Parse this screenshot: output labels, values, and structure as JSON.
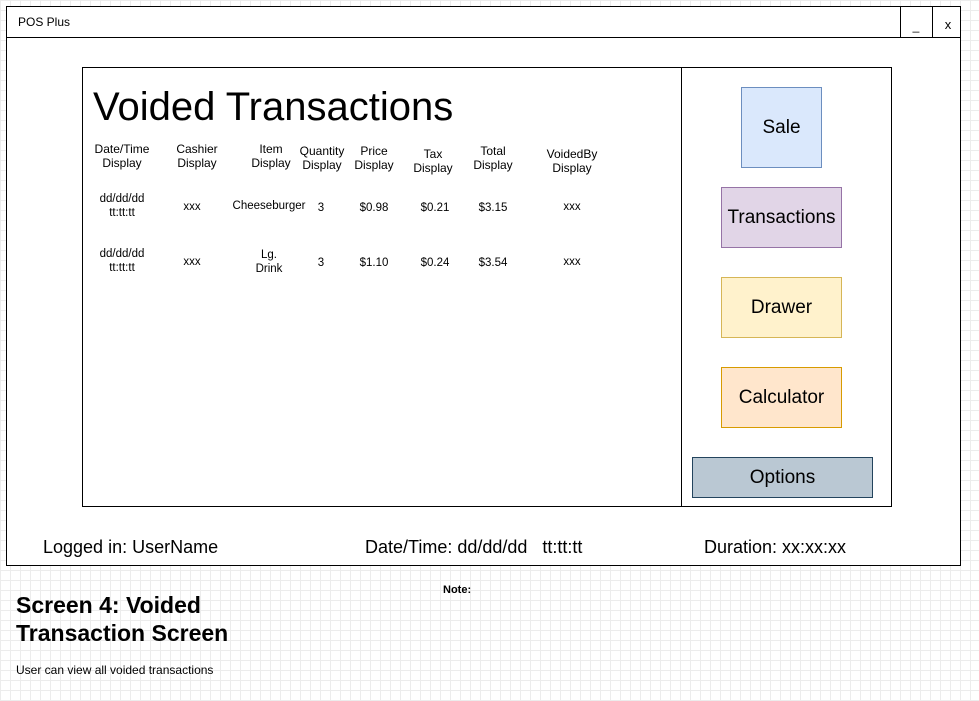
{
  "window": {
    "title": "POS Plus",
    "minimize_label": "_",
    "close_label": "x"
  },
  "main": {
    "title": "Voided Transactions",
    "columns": [
      [
        "Date/Time",
        "Display"
      ],
      [
        "Cashier",
        "Display"
      ],
      [
        "Item",
        "Display"
      ],
      [
        "Quantity",
        "Display"
      ],
      [
        "Price",
        "Display"
      ],
      [
        "Tax",
        "Display"
      ],
      [
        "Total",
        "Display"
      ],
      [
        "VoidedBy",
        "Display"
      ]
    ],
    "rows": [
      [
        [
          "dd/dd/dd",
          "tt:tt:tt"
        ],
        [
          "xxx"
        ],
        [
          "Cheeseburger"
        ],
        [
          "3"
        ],
        [
          "$0.98"
        ],
        [
          "$0.21"
        ],
        [
          "$3.15"
        ],
        [
          "xxx"
        ]
      ],
      [
        [
          "dd/dd/dd",
          "tt:tt:tt"
        ],
        [
          "xxx"
        ],
        [
          "Lg.",
          "Drink"
        ],
        [
          "3"
        ],
        [
          "$1.10"
        ],
        [
          "$0.24"
        ],
        [
          "$3.54"
        ],
        [
          "xxx"
        ]
      ]
    ]
  },
  "sidebar": {
    "sale": "Sale",
    "transactions": "Transactions",
    "drawer": "Drawer",
    "calculator": "Calculator",
    "options": "Options",
    "colors": {
      "sale": "#dae8fc",
      "transactions": "#e1d5e7",
      "drawer": "#fff2cc",
      "calculator": "#ffe6cc",
      "options": "#bac8d3"
    }
  },
  "status": {
    "logged_in": "Logged in: UserName",
    "datetime": "Date/Time: dd/dd/dd   tt:tt:tt",
    "duration": "Duration: xx:xx:xx"
  },
  "annotation": {
    "title_line1": "Screen 4: Voided",
    "title_line2": "Transaction Screen",
    "description": "User can view all voided transactions",
    "note_label": "Note:"
  }
}
